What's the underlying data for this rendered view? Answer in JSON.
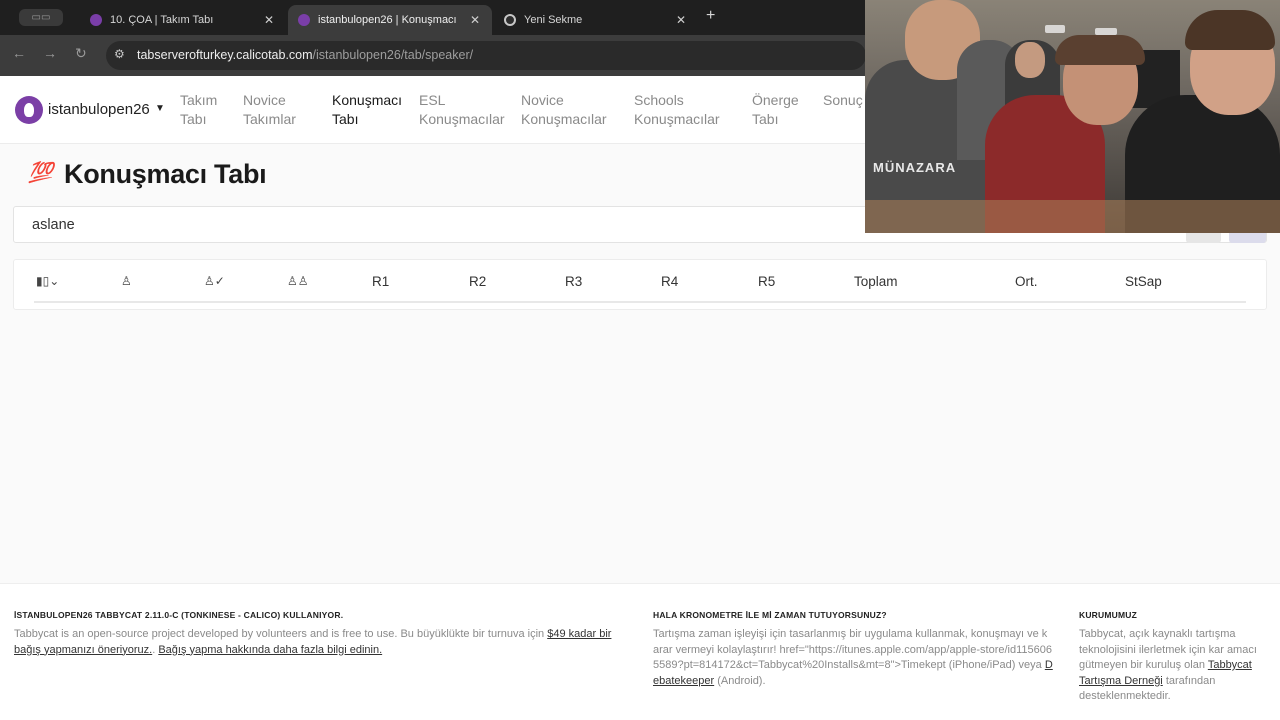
{
  "browser": {
    "tabs": [
      {
        "title": "10. ÇOA | Takım Tabı",
        "active": false
      },
      {
        "title": "istanbulopen26 | Konuşmacı",
        "active": true
      },
      {
        "title": "Yeni Sekme",
        "active": false
      }
    ],
    "url_host": "tabserverofturkey.calicotab.com",
    "url_path": "/istanbulopen26/tab/speaker/"
  },
  "nav": {
    "brand": "istanbulopen26",
    "items": [
      {
        "line1": "Takım",
        "line2": "Tabı"
      },
      {
        "line1": "Novice",
        "line2": "Takımlar"
      },
      {
        "line1": "Konuşmacı",
        "line2": "Tabı"
      },
      {
        "line1": "ESL",
        "line2": "Konuşmacılar"
      },
      {
        "line1": "Novice",
        "line2": "Konuşmacılar"
      },
      {
        "line1": "Schools",
        "line2": "Konuşmacılar"
      },
      {
        "line1": "Önerge",
        "line2": "Tabı"
      },
      {
        "line1": "Sonuç",
        "line2": ""
      }
    ]
  },
  "page": {
    "title_icon": "💯",
    "title": "Konuşmacı Tabı"
  },
  "search": {
    "value": "aslane"
  },
  "table": {
    "icon_columns": [
      "rank-sort-icon",
      "person-icon",
      "person-check-icon",
      "people-icon"
    ],
    "headers": [
      "R1",
      "R2",
      "R3",
      "R4",
      "R5",
      "Toplam",
      "Ort.",
      "StSap"
    ]
  },
  "footer": {
    "col1": {
      "heading": "İSTANBULOPEN26 TABBYCAT 2.11.0-C (TONKINESE - CALICO) KULLANIYOR.",
      "text": "Tabbycat is an open-source project developed by volunteers and is free to use. Bu büyüklükte bir turnuva için",
      "link1": "$49 kadar bir bağış yapmanızı öneriyoruz.",
      "sep": ".",
      "link2": "Bağış yapma hakkında daha fazla bilgi edinin."
    },
    "col2": {
      "heading": "HALA KRONOMETRE İLE Mİ ZAMAN TUTUYORSUNUZ?",
      "text": "Tartışma zaman işleyişi için tasarlanmış bir uygulama kullanmak, konuşmayı ve karar vermeyi kolaylaştırır! href=\"https://itunes.apple.com/app/apple-store/id1156065589?pt=814172&ct=Tabbycat%20Installs&mt=8\">Timekept (iPhone/iPad) veya",
      "link": "Debatekeeper",
      "tail": "(Android)."
    },
    "col3": {
      "heading": "KURUMUMUZ",
      "text": "Tabbycat, açık kaynaklı tartışma teknolojisini ilerletmek için kar amacı gütmeyen bir kuruluş olan",
      "link": "Tabbycat Tartışma Derneği",
      "tail": "tarafından desteklenmektedir."
    }
  },
  "overlay": {
    "shirt_text": "MÜNAZARA"
  }
}
